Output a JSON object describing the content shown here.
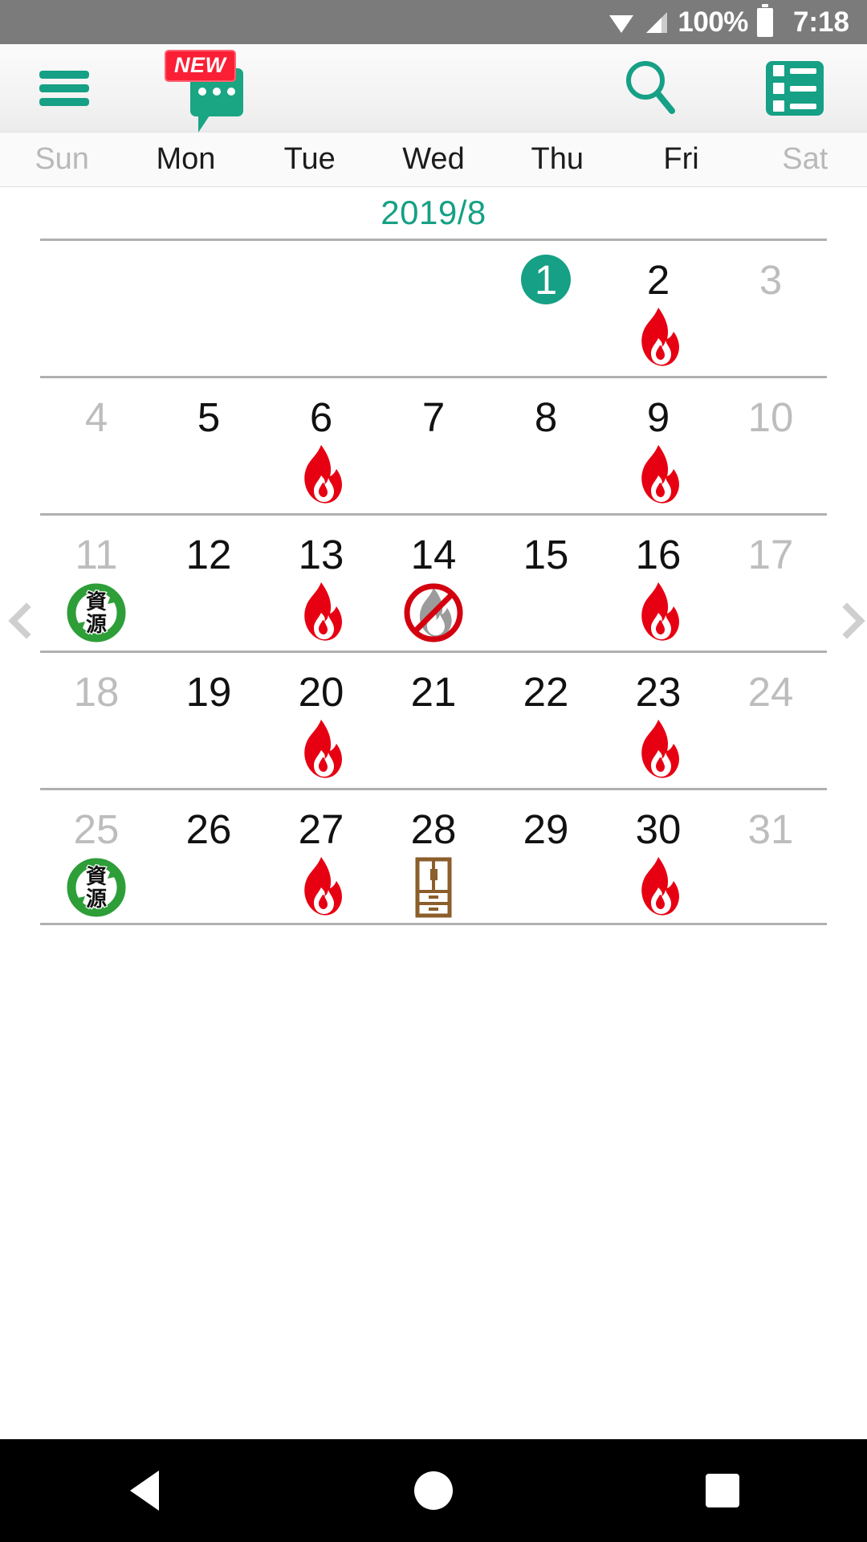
{
  "status_bar": {
    "wifi_icon": "wifi-icon",
    "signal_icon": "signal-icon",
    "battery_percent": "100%",
    "battery_icon": "battery-icon",
    "time": "7:18"
  },
  "toolbar": {
    "menu_icon": "hamburger-menu-icon",
    "chat_icon": "chat-bubble-icon",
    "chat_badge": "NEW",
    "search_icon": "search-icon",
    "list_icon": "list-view-icon"
  },
  "weekdays": [
    {
      "label": "Sun",
      "dim": true
    },
    {
      "label": "Mon",
      "dim": false
    },
    {
      "label": "Tue",
      "dim": false
    },
    {
      "label": "Wed",
      "dim": false
    },
    {
      "label": "Thu",
      "dim": false
    },
    {
      "label": "Fri",
      "dim": false
    },
    {
      "label": "Sat",
      "dim": true
    }
  ],
  "month": {
    "title": "2019/8"
  },
  "nav": {
    "prev_icon": "chevron-left-icon",
    "next_icon": "chevron-right-icon"
  },
  "calendar": {
    "weeks": [
      [
        {
          "day": "",
          "dim": false,
          "selected": false,
          "icon": ""
        },
        {
          "day": "",
          "dim": false,
          "selected": false,
          "icon": ""
        },
        {
          "day": "",
          "dim": false,
          "selected": false,
          "icon": ""
        },
        {
          "day": "",
          "dim": false,
          "selected": false,
          "icon": ""
        },
        {
          "day": "1",
          "dim": false,
          "selected": true,
          "icon": ""
        },
        {
          "day": "2",
          "dim": false,
          "selected": false,
          "icon": "flame"
        },
        {
          "day": "3",
          "dim": true,
          "selected": false,
          "icon": ""
        }
      ],
      [
        {
          "day": "4",
          "dim": true,
          "selected": false,
          "icon": ""
        },
        {
          "day": "5",
          "dim": false,
          "selected": false,
          "icon": ""
        },
        {
          "day": "6",
          "dim": false,
          "selected": false,
          "icon": "flame"
        },
        {
          "day": "7",
          "dim": false,
          "selected": false,
          "icon": ""
        },
        {
          "day": "8",
          "dim": false,
          "selected": false,
          "icon": ""
        },
        {
          "day": "9",
          "dim": false,
          "selected": false,
          "icon": "flame"
        },
        {
          "day": "10",
          "dim": true,
          "selected": false,
          "icon": ""
        }
      ],
      [
        {
          "day": "11",
          "dim": true,
          "selected": false,
          "icon": "recycle"
        },
        {
          "day": "12",
          "dim": false,
          "selected": false,
          "icon": ""
        },
        {
          "day": "13",
          "dim": false,
          "selected": false,
          "icon": "flame"
        },
        {
          "day": "14",
          "dim": false,
          "selected": false,
          "icon": "no-flame"
        },
        {
          "day": "15",
          "dim": false,
          "selected": false,
          "icon": ""
        },
        {
          "day": "16",
          "dim": false,
          "selected": false,
          "icon": "flame"
        },
        {
          "day": "17",
          "dim": true,
          "selected": false,
          "icon": ""
        }
      ],
      [
        {
          "day": "18",
          "dim": true,
          "selected": false,
          "icon": ""
        },
        {
          "day": "19",
          "dim": false,
          "selected": false,
          "icon": ""
        },
        {
          "day": "20",
          "dim": false,
          "selected": false,
          "icon": "flame"
        },
        {
          "day": "21",
          "dim": false,
          "selected": false,
          "icon": ""
        },
        {
          "day": "22",
          "dim": false,
          "selected": false,
          "icon": ""
        },
        {
          "day": "23",
          "dim": false,
          "selected": false,
          "icon": "flame"
        },
        {
          "day": "24",
          "dim": true,
          "selected": false,
          "icon": ""
        }
      ],
      [
        {
          "day": "25",
          "dim": true,
          "selected": false,
          "icon": "recycle"
        },
        {
          "day": "26",
          "dim": false,
          "selected": false,
          "icon": ""
        },
        {
          "day": "27",
          "dim": false,
          "selected": false,
          "icon": "flame"
        },
        {
          "day": "28",
          "dim": false,
          "selected": false,
          "icon": "furniture"
        },
        {
          "day": "29",
          "dim": false,
          "selected": false,
          "icon": ""
        },
        {
          "day": "30",
          "dim": false,
          "selected": false,
          "icon": "flame"
        },
        {
          "day": "31",
          "dim": true,
          "selected": false,
          "icon": ""
        }
      ]
    ],
    "icon_labels": {
      "flame": "burnable-trash-flame-icon",
      "no-flame": "no-burnable-trash-icon",
      "recycle": "recycle-resources-icon",
      "furniture": "bulky-furniture-icon"
    },
    "recycle_text": "資源"
  },
  "bottom_nav": {
    "back": "back-nav-icon",
    "home": "home-nav-icon",
    "recents": "recents-nav-icon"
  },
  "colors": {
    "accent": "#16a085",
    "flame_red": "#e60012",
    "recycle_green": "#2e9e38",
    "furniture_brown": "#8b5e2b",
    "status_bar": "#7b7b7b"
  }
}
